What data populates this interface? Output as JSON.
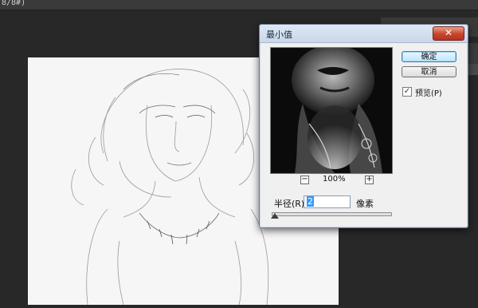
{
  "app": {
    "titlebar_text": "8/8#)"
  },
  "dialog": {
    "title": "最小值",
    "close_glyph": "✕",
    "ok_label": "确定",
    "cancel_label": "取消",
    "preview_label": "预览(P)",
    "preview_checked": true,
    "preview_check_glyph": "✓",
    "zoom_out_glyph": "−",
    "zoom_in_glyph": "+",
    "zoom_level": "100%",
    "radius_label": "半径(R):",
    "radius_value": "2",
    "radius_unit": "像素"
  },
  "icons": {
    "close": "close-icon",
    "zoom_out": "minus-icon",
    "zoom_in": "plus-icon",
    "check": "check-icon",
    "slider_thumb": "triangle-thumb-icon"
  },
  "colors": {
    "workspace": "#282828",
    "canvas": "#f6f6f6",
    "dialog_bg": "#f0f0f0",
    "close_red": "#c7432c",
    "selection_blue": "#3399ff"
  }
}
